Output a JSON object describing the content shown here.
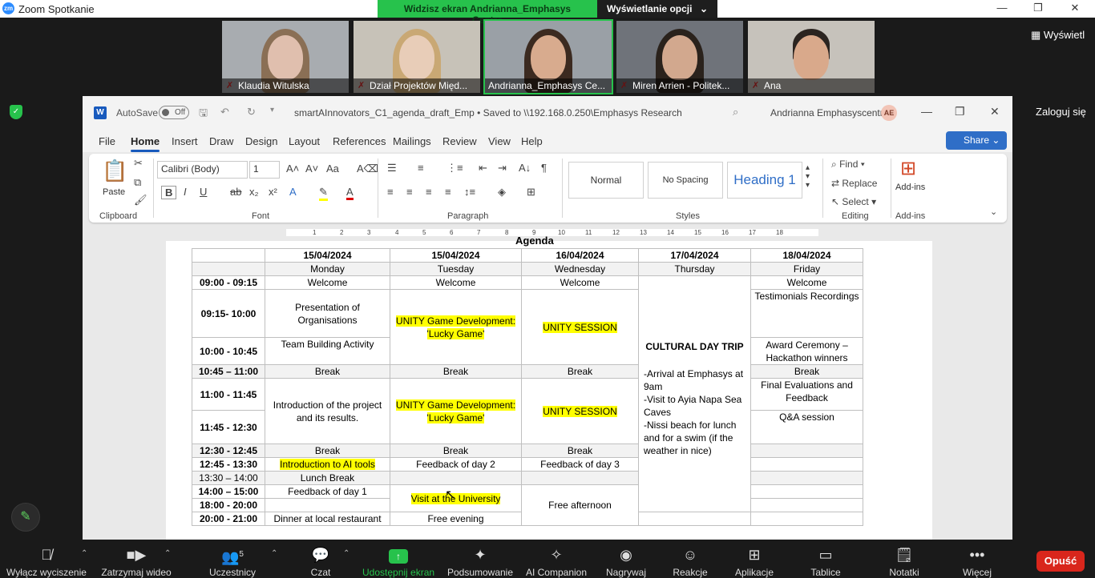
{
  "zoom": {
    "window_title": "Zoom Spotkanie",
    "logo": "zm",
    "share_banner": "Widzisz ekran Andrianna_Emphasys Centre",
    "view_options": "Wyświetlanie opcji",
    "view_button": "Wyświetl",
    "login": "Zaloguj się",
    "participants": [
      {
        "name": "Klaudia Witulska"
      },
      {
        "name": "Dział Projektów Międ..."
      },
      {
        "name": "Andrianna_Emphasys Ce..."
      },
      {
        "name": "Miren Arrien - Politek..."
      },
      {
        "name": "Ana"
      }
    ],
    "toolbar": [
      {
        "label": "Wyłącz wyciszenie",
        "icon": "mic-off-icon"
      },
      {
        "label": "Zatrzymaj wideo",
        "icon": "video-icon"
      },
      {
        "label": "Uczestnicy",
        "icon": "participants-icon",
        "count": "5"
      },
      {
        "label": "Czat",
        "icon": "chat-icon"
      },
      {
        "label": "Udostępnij ekran",
        "icon": "share-screen-icon"
      },
      {
        "label": "Podsumowanie",
        "icon": "summary-icon"
      },
      {
        "label": "AI Companion",
        "icon": "ai-companion-icon"
      },
      {
        "label": "Nagrywaj",
        "icon": "record-icon"
      },
      {
        "label": "Reakcje",
        "icon": "reactions-icon"
      },
      {
        "label": "Aplikacje",
        "icon": "apps-icon"
      },
      {
        "label": "Tablice",
        "icon": "whiteboard-icon"
      },
      {
        "label": "Notatki",
        "icon": "notes-icon"
      },
      {
        "label": "Więcej",
        "icon": "more-icon"
      }
    ],
    "leave": "Opuść",
    "accent": "#27c24c",
    "leave_color": "#d9261c"
  },
  "word": {
    "autosave": "AutoSave",
    "autosave_state": "Off",
    "doc_title": "smartAInnovators_C1_agenda_draft_Emp  •  Saved to \\\\192.168.0.250\\Emphasys Research",
    "user": "Andrianna Emphasyscentre",
    "initials": "AE",
    "tabs": [
      "File",
      "Home",
      "Insert",
      "Draw",
      "Design",
      "Layout",
      "References",
      "Mailings",
      "Review",
      "View",
      "Help"
    ],
    "share": "Share",
    "ribbon": {
      "paste": "Paste",
      "font_name": "Calibri (Body)",
      "font_size": "1",
      "groups": [
        "Clipboard",
        "Font",
        "Paragraph",
        "Styles",
        "Editing",
        "Add-ins"
      ],
      "styles": [
        "Normal",
        "No Spacing",
        "Heading 1"
      ],
      "find": "Find",
      "replace": "Replace",
      "select": "Select",
      "addins": "Add-ins"
    },
    "ruler_numbers": [
      "1",
      "2",
      "3",
      "4",
      "5",
      "6",
      "7",
      "8",
      "9",
      "10",
      "11",
      "12",
      "13",
      "14",
      "15",
      "16",
      "17",
      "18"
    ],
    "agenda_title": "Agenda",
    "agenda": {
      "dates": [
        "15/04/2024",
        "15/04/2024",
        "16/04/2024",
        "17/04/2024",
        "18/04/2024"
      ],
      "days": [
        "Monday",
        "Tuesday",
        "Wednesday",
        "Thursday",
        "Friday"
      ],
      "times": [
        "09:00 - 09:15",
        "09:15- 10:00",
        "10:00 - 10:45",
        "10:45 – 11:00",
        "11:00 - 11:45",
        "11:45 - 12:30",
        "12:30 - 12:45",
        "12:45 - 13:30",
        "13:30 – 14:00",
        "14:00 – 15:00",
        "18:00 - 20:00",
        "20:00 - 21:00"
      ],
      "welcome": "Welcome",
      "presentation": "Presentation of Organisations",
      "team_building": "Team Building Activity",
      "unity_dev": "UNITY Game Development: 'Lucky Game'",
      "unity_session": "UNITY SESSION",
      "break": "Break",
      "intro_project": "Introduction of the project and its results.",
      "intro_ai": "Introduction to AI tools",
      "feedback2": "Feedback of day 2",
      "feedback3": "Feedback of day 3",
      "lunch": "Lunch Break",
      "feedback1": "Feedback of day 1",
      "visit": "Visit at the University",
      "free_afternoon": "Free afternoon",
      "dinner": "Dinner at local restaurant",
      "free_evening": "Free evening",
      "trip_title": "CULTURAL DAY TRIP",
      "trip_lines": [
        "-Arrival at Emphasys at 9am",
        "-Visit to Ayia Napa Sea Caves",
        "-Nissi beach for lunch and for a swim (if the weather in nice)"
      ],
      "testimonials": "Testimonials Recordings",
      "award": "Award Ceremony – Hackathon winners",
      "final_eval": "Final Evaluations and Feedback",
      "qa": "Q&A session"
    }
  }
}
